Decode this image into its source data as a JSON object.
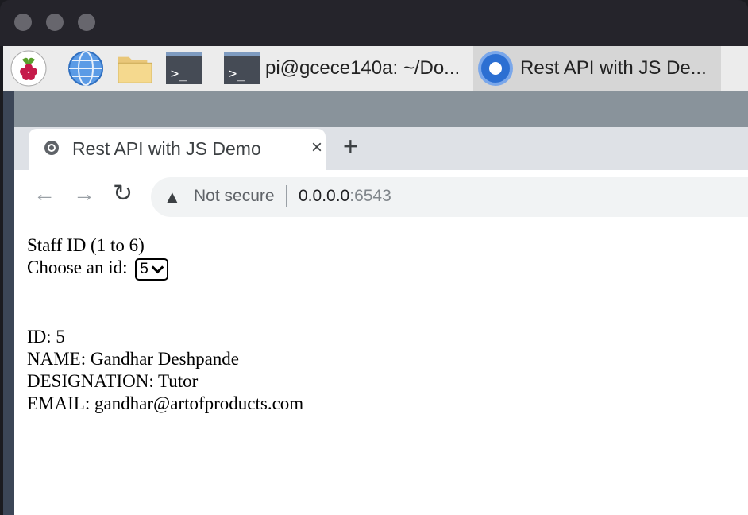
{
  "taskbar": {
    "terminal_task_label": "pi@gcece140a: ~/Do...",
    "browser_task_label": "Rest API with JS De..."
  },
  "browser": {
    "tab_title": "Rest API with JS Demo",
    "tab_close": "×",
    "new_tab": "+",
    "security_label": "Not secure",
    "url_host": "0.0.0.0",
    "url_port": ":6543"
  },
  "page": {
    "heading": "Staff ID (1 to 6)",
    "select_label": "Choose an id:",
    "select_value": "5",
    "id_line": "ID: 5",
    "name_line": "NAME: Gandhar Deshpande",
    "designation_line": "DESIGNATION: Tutor",
    "email_line": "EMAIL: gandhar@artofproducts.com"
  },
  "colors": {
    "accent": "#2c6fd2",
    "titlebar": "#25242b",
    "decor": "#89939b"
  }
}
